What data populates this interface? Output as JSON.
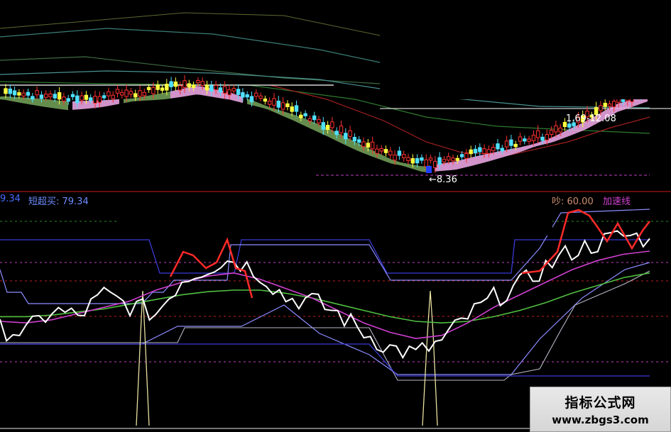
{
  "colors": {
    "up": "#ff3030",
    "down": "#4fe0ff",
    "ribbon_down": "#6f9c55",
    "ribbon_up": "#e8a3e0",
    "white_line": "#ffffff",
    "red_line": "#ff2a2a",
    "magenta": "#d040d0",
    "green": "#50c040",
    "blue": "#3a3ad8",
    "lav": "#8c8cff",
    "gray": "#b8b8c8",
    "spike": "#e8e0a0",
    "ref_purple": "#c040c0",
    "ref_red": "#c02020",
    "ref_green": "#2a8a2a"
  },
  "upper_panel": {
    "low_label": "←8.36",
    "zone_label": "1.69-12.08"
  },
  "lower_panel": {
    "left_value": "9.34",
    "short_buy_label": "短超买: 79.34",
    "right_value_label": "吵: 60.00",
    "accel_label": "加速线"
  },
  "watermark": {
    "title": "指标公式网",
    "url": "www.zbgs3.com"
  },
  "chart_data": [
    {
      "type": "line",
      "name": "upper-candlestick-panel",
      "annotations": [
        "←8.36",
        "1.69-12.08"
      ],
      "series": [
        {
          "name": "",
          "values": [
            12.0,
            11.8,
            11.6,
            11.7,
            11.9,
            12.1,
            12.4,
            12.1,
            11.6,
            11.0,
            10.3,
            9.5,
            8.8,
            8.4,
            8.6,
            9.0,
            9.4,
            9.9,
            10.6,
            11.5,
            12.0
          ]
        }
      ]
    },
    {
      "type": "line",
      "name": "lower-indicator-panel",
      "annotations": [
        "9.34",
        "短超买: 79.34",
        "吵: 60.00",
        "加速线"
      ],
      "series": [
        {
          "name": "",
          "values": [
            30,
            28,
            42,
            38,
            52,
            45,
            40,
            62,
            70,
            75,
            66,
            50,
            48,
            40,
            28,
            18,
            14,
            22,
            38,
            50,
            58,
            70,
            80,
            85,
            90,
            88
          ]
        },
        {
          "name": "",
          "values": [
            35,
            34,
            36,
            40,
            44,
            48,
            55,
            60,
            64,
            66,
            62,
            56,
            50,
            42,
            34,
            28,
            24,
            26,
            34,
            44,
            52,
            60,
            68,
            74,
            78,
            80
          ]
        },
        {
          "name": "",
          "values": [
            38,
            38,
            39,
            41,
            43,
            46,
            49,
            52,
            54,
            55,
            55,
            53,
            50,
            46,
            42,
            38,
            35,
            34,
            35,
            38,
            42,
            47,
            53,
            58,
            63,
            66
          ]
        }
      ]
    }
  ]
}
